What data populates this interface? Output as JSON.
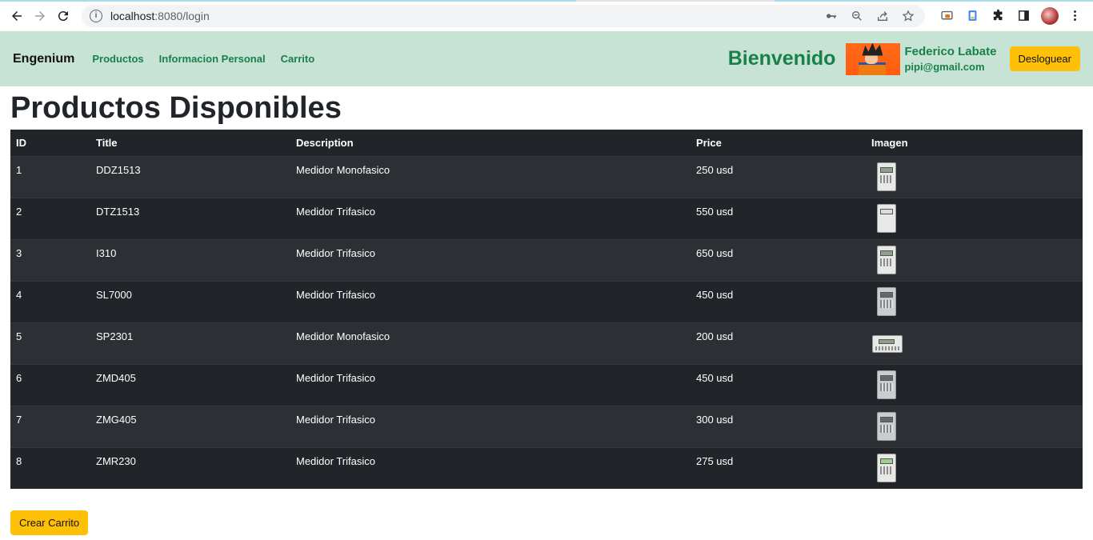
{
  "browser": {
    "url_host": "localhost",
    "url_path": ":8080/login"
  },
  "navbar": {
    "brand": "Engenium",
    "links": [
      "Productos",
      "Informacion Personal",
      "Carrito"
    ],
    "welcome": "Bienvenido",
    "user_name": "Federico Labate",
    "user_email": "pipi@gmail.com",
    "logout_label": "Desloguear"
  },
  "main": {
    "title": "Productos Disponibles",
    "columns": [
      "ID",
      "Title",
      "Description",
      "Price",
      "Imagen"
    ],
    "rows": [
      {
        "id": "1",
        "title": "DDZ1513",
        "description": "Medidor Monofasico",
        "price": "250 usd"
      },
      {
        "id": "2",
        "title": "DTZ1513",
        "description": "Medidor Trifasico",
        "price": "550 usd"
      },
      {
        "id": "3",
        "title": "I310",
        "description": "Medidor Trifasico",
        "price": "650 usd"
      },
      {
        "id": "4",
        "title": "SL7000",
        "description": "Medidor Trifasico",
        "price": "450 usd"
      },
      {
        "id": "5",
        "title": "SP2301",
        "description": "Medidor Monofasico",
        "price": "200 usd"
      },
      {
        "id": "6",
        "title": "ZMD405",
        "description": "Medidor Trifasico",
        "price": "450 usd"
      },
      {
        "id": "7",
        "title": "ZMG405",
        "description": "Medidor Trifasico",
        "price": "300 usd"
      },
      {
        "id": "8",
        "title": "ZMR230",
        "description": "Medidor Trifasico",
        "price": "275 usd"
      }
    ],
    "create_cart_label": "Crear Carrito"
  },
  "colors": {
    "navbar_bg": "#c7e3d6",
    "accent_green": "#1a8049",
    "warning": "#ffc107",
    "table_dark": "#212529"
  }
}
